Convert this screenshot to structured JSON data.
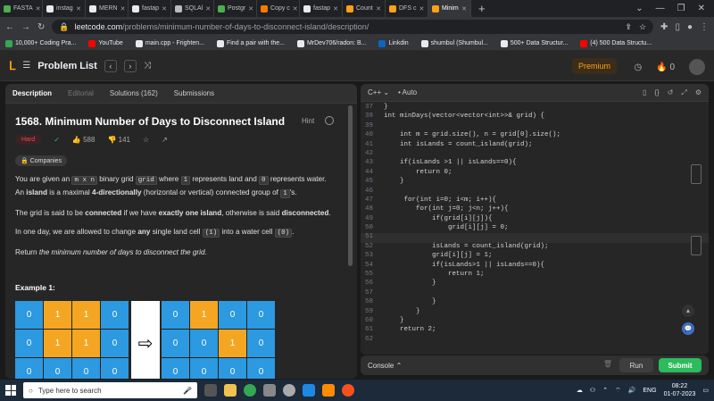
{
  "browser": {
    "tabs": [
      {
        "label": "FASTA",
        "color": "#4caf50",
        "active": false
      },
      {
        "label": "instag",
        "color": "#e8eaed",
        "active": false
      },
      {
        "label": "MERN",
        "color": "#e8eaed",
        "active": false
      },
      {
        "label": "fastap",
        "color": "#e8eaed",
        "active": false
      },
      {
        "label": "SQLAl",
        "color": "#bbbbbb",
        "active": false
      },
      {
        "label": "Postgr",
        "color": "#4caf50",
        "active": false
      },
      {
        "label": "Copy c",
        "color": "#f57c00",
        "active": false
      },
      {
        "label": "fastap",
        "color": "#e8eaed",
        "active": false
      },
      {
        "label": "Count",
        "color": "#ffa116",
        "active": false
      },
      {
        "label": "DFS c",
        "color": "#ffa116",
        "active": false
      },
      {
        "label": "Minim",
        "color": "#ffa116",
        "active": true
      }
    ],
    "url_domain": "leetcode.com",
    "url_path": "/problems/minimum-number-of-days-to-disconnect-island/description/",
    "bookmarks": [
      {
        "label": "10,000+ Coding Pra...",
        "color": "#34a853"
      },
      {
        "label": "YouTube",
        "color": "#ff0000"
      },
      {
        "label": "main.cpp - Frighten...",
        "color": "#e8eaed"
      },
      {
        "label": "Find a pair with the...",
        "color": "#e8eaed"
      },
      {
        "label": "MrDev706/radon: B...",
        "color": "#e8eaed"
      },
      {
        "label": "Linkdin",
        "color": "#0a66c2"
      },
      {
        "label": "shumbul (Shumbul...",
        "color": "#e8eaed"
      },
      {
        "label": "500+ Data Structur...",
        "color": "#e8eaed"
      },
      {
        "label": "(4) 500 Data Structu...",
        "color": "#ff0000"
      }
    ]
  },
  "nav": {
    "title": "Problem List",
    "premium": "Premium",
    "streak": "0"
  },
  "problem": {
    "tabs": {
      "description": "Description",
      "editorial": "Editorial",
      "solutions": "Solutions (162)",
      "submissions": "Submissions"
    },
    "title": "1568. Minimum Number of Days to Disconnect Island",
    "hint": "Hint",
    "difficulty": "Hard",
    "likes": "588",
    "dislikes": "141",
    "companies": "Companies",
    "desc1_a": "You are given an ",
    "desc1_code1": "m x n",
    "desc1_b": " binary grid ",
    "desc1_code2": "grid",
    "desc1_c": " where ",
    "desc1_code3": "1",
    "desc1_d": " represents land and ",
    "desc1_code4": "0",
    "desc1_e": " represents water. An ",
    "desc1_bold1": "island",
    "desc1_f": " is a maximal ",
    "desc1_bold2": "4-directionally",
    "desc1_g": " (horizontal or vertical) connected group of ",
    "desc1_code5": "1",
    "desc1_h": "'s.",
    "desc2_a": "The grid is said to be ",
    "desc2_bold1": "connected",
    "desc2_b": " if we have ",
    "desc2_bold2": "exactly one island",
    "desc2_c": ", otherwise is said ",
    "desc2_bold3": "disconnected",
    "desc2_d": ".",
    "desc3_a": "In one day, we are allowed to change ",
    "desc3_bold": "any",
    "desc3_b": " single land cell ",
    "desc3_code1": "(1)",
    "desc3_c": " into a water cell ",
    "desc3_code2": "(0)",
    "desc3_d": ".",
    "desc4_a": "Return ",
    "desc4_em": "the minimum number of days to disconnect the grid",
    "desc4_b": ".",
    "example_title": "Example 1:",
    "grid_before": [
      [
        0,
        1,
        1,
        0
      ],
      [
        0,
        1,
        1,
        0
      ],
      [
        0,
        0,
        0,
        0
      ]
    ],
    "grid_after": [
      [
        0,
        1,
        0,
        0
      ],
      [
        0,
        0,
        1,
        0
      ],
      [
        0,
        0,
        0,
        0
      ]
    ]
  },
  "editor": {
    "language": "C++",
    "mode": "Auto",
    "lines": [
      {
        "n": "37",
        "code": "}"
      },
      {
        "n": "38",
        "code": "int minDays(vector<vector<int>>& grid) {"
      },
      {
        "n": "39",
        "code": ""
      },
      {
        "n": "40",
        "code": "    int m = grid.size(), n = grid[0].size();"
      },
      {
        "n": "41",
        "code": "    int isLands = count_island(grid);"
      },
      {
        "n": "42",
        "code": ""
      },
      {
        "n": "43",
        "code": "    if(isLands >1 || isLands==0){"
      },
      {
        "n": "44",
        "code": "        return 0;"
      },
      {
        "n": "45",
        "code": "    }"
      },
      {
        "n": "46",
        "code": ""
      },
      {
        "n": "47",
        "code": "     for(int i=0; i<m; i++){"
      },
      {
        "n": "48",
        "code": "        for(int j=0; j<n; j++){"
      },
      {
        "n": "49",
        "code": "            if(grid[i][j]){"
      },
      {
        "n": "50",
        "code": "                grid[i][j] = 0;"
      },
      {
        "n": "51",
        "code": ""
      },
      {
        "n": "52",
        "code": "            isLands = count_island(grid);"
      },
      {
        "n": "53",
        "code": "            grid[i][j] = 1;"
      },
      {
        "n": "54",
        "code": "            if(isLands>1 || isLands==0){"
      },
      {
        "n": "55",
        "code": "                return 1;"
      },
      {
        "n": "56",
        "code": "            }"
      },
      {
        "n": "57",
        "code": ""
      },
      {
        "n": "58",
        "code": "            }"
      },
      {
        "n": "59",
        "code": "        }"
      },
      {
        "n": "60",
        "code": "    }"
      },
      {
        "n": "61",
        "code": "    return 2;"
      },
      {
        "n": "62",
        "code": ""
      }
    ],
    "console": "Console",
    "run": "Run",
    "submit": "Submit"
  },
  "taskbar": {
    "search_placeholder": "Type here to search",
    "lang": "ENG",
    "time": "08:22",
    "date": "01-07-2023"
  }
}
